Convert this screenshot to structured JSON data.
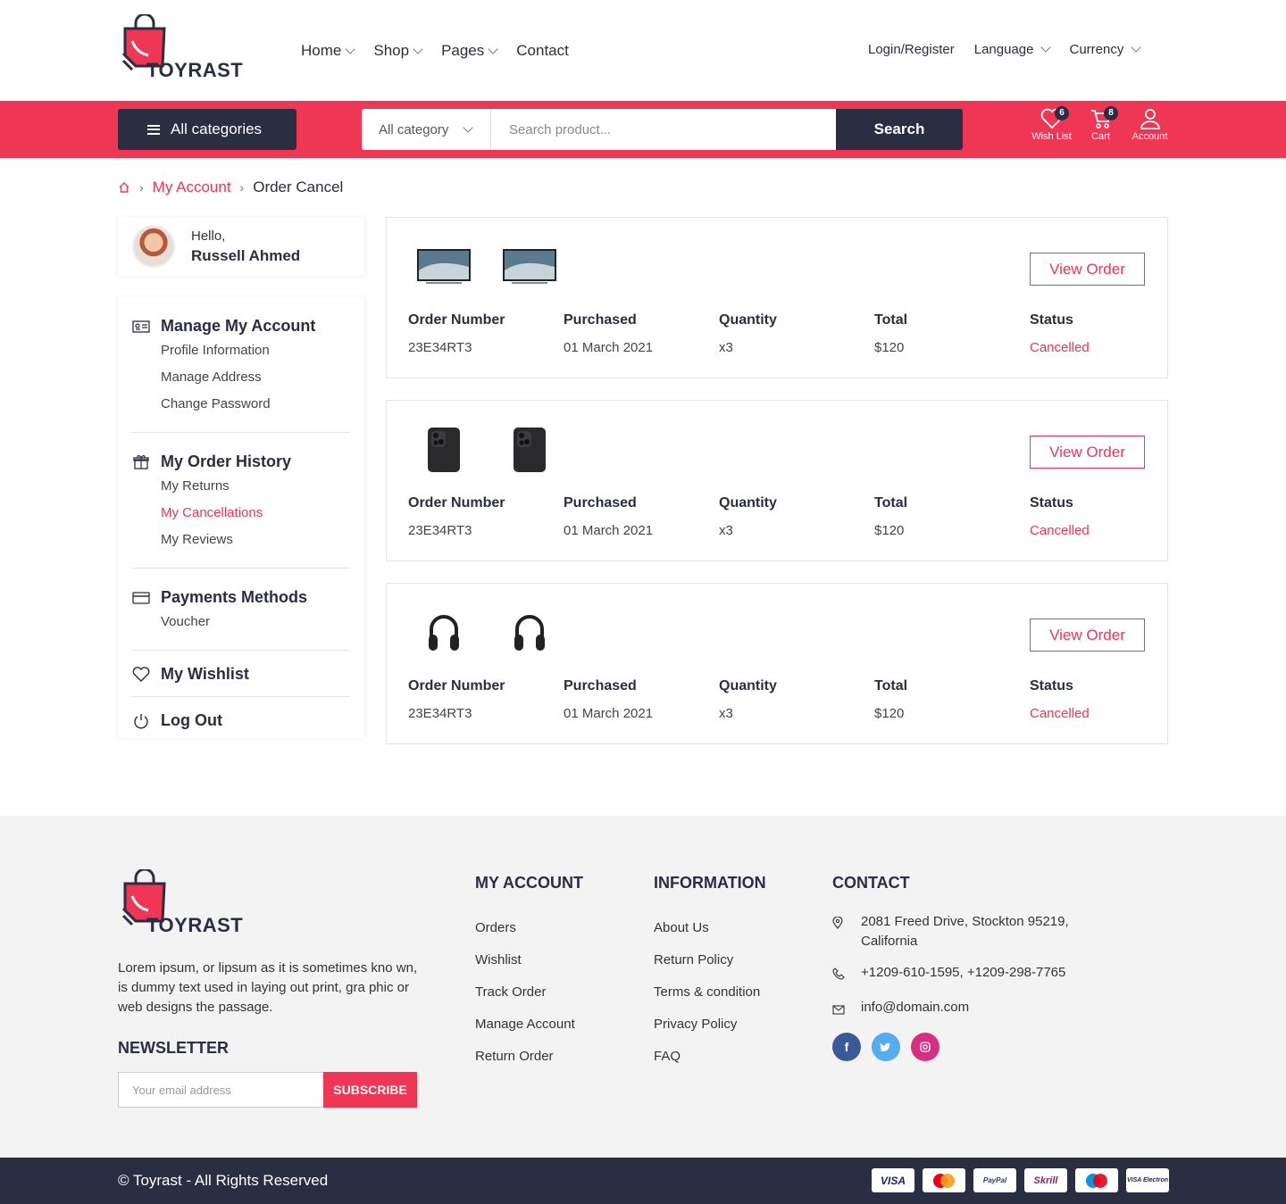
{
  "brand": {
    "name": "TOYRAST",
    "accent": "#ef3654",
    "dark": "#2b2d42"
  },
  "nav": {
    "items": [
      "Home",
      "Shop",
      "Pages",
      "Contact"
    ],
    "login": "Login/Register",
    "language": "Language",
    "currency": "Currency"
  },
  "bar": {
    "all_categories": "All categories",
    "category_select": "All category",
    "search_placeholder": "Search product...",
    "search_button": "Search",
    "wishlist_label": "Wish List",
    "wishlist_count": "6",
    "cart_label": "Cart",
    "cart_count": "8",
    "account_label": "Account"
  },
  "breadcrumb": {
    "parent": "My Account",
    "current": "Order Cancel"
  },
  "profile": {
    "greeting": "Hello,",
    "name": "Russell Ahmed"
  },
  "menu": {
    "manage": {
      "title": "Manage My Account",
      "items": [
        "Profile Information",
        "Manage Address",
        "Change Password"
      ]
    },
    "orders": {
      "title": "My Order History",
      "items": [
        "My Returns",
        "My Cancellations",
        "My Reviews"
      ]
    },
    "payments": {
      "title": "Payments Methods",
      "items": [
        "Voucher"
      ]
    },
    "wishlist": "My Wishlist",
    "logout": "Log Out"
  },
  "order_labels": {
    "number": "Order Number",
    "purchased": "Purchased",
    "quantity": "Quantity",
    "total": "Total",
    "status": "Status",
    "view": "View Order"
  },
  "orders": [
    {
      "product_icon": "tv-icon",
      "number": "23E34RT3",
      "purchased": "01 March 2021",
      "quantity": "x3",
      "total": "$120",
      "status": "Cancelled"
    },
    {
      "product_icon": "phone-icon",
      "number": "23E34RT3",
      "purchased": "01 March 2021",
      "quantity": "x3",
      "total": "$120",
      "status": "Cancelled"
    },
    {
      "product_icon": "headphones-icon",
      "number": "23E34RT3",
      "purchased": "01 March 2021",
      "quantity": "x3",
      "total": "$120",
      "status": "Cancelled"
    }
  ],
  "footer": {
    "about": "Lorem ipsum, or lipsum as it is sometimes kno wn, is dummy text used in laying out print, gra phic or web designs the passage.",
    "newsletter_title": "NEWSLETTER",
    "email_placeholder": "Your email address",
    "subscribe": "SUBSCRIBE",
    "my_account": {
      "title": "MY ACCOUNT",
      "links": [
        "Orders",
        "Wishlist",
        "Track Order",
        "Manage Account",
        "Return Order"
      ]
    },
    "information": {
      "title": "INFORMATION",
      "links": [
        "About Us",
        "Return Policy",
        "Terms & condition",
        "Privacy Policy",
        "FAQ"
      ]
    },
    "contact": {
      "title": "CONTACT",
      "address": "2081 Freed Drive, Stockton 95219, California",
      "phone": "+1209-610-1595, +1209-298-7765",
      "email": "info@domain.com"
    },
    "copyright": "© Toyrast - All Rights Reserved",
    "payments": [
      "VISA",
      "MasterCard",
      "PayPal",
      "Skrill",
      "Maestro",
      "VISA Electron"
    ]
  }
}
